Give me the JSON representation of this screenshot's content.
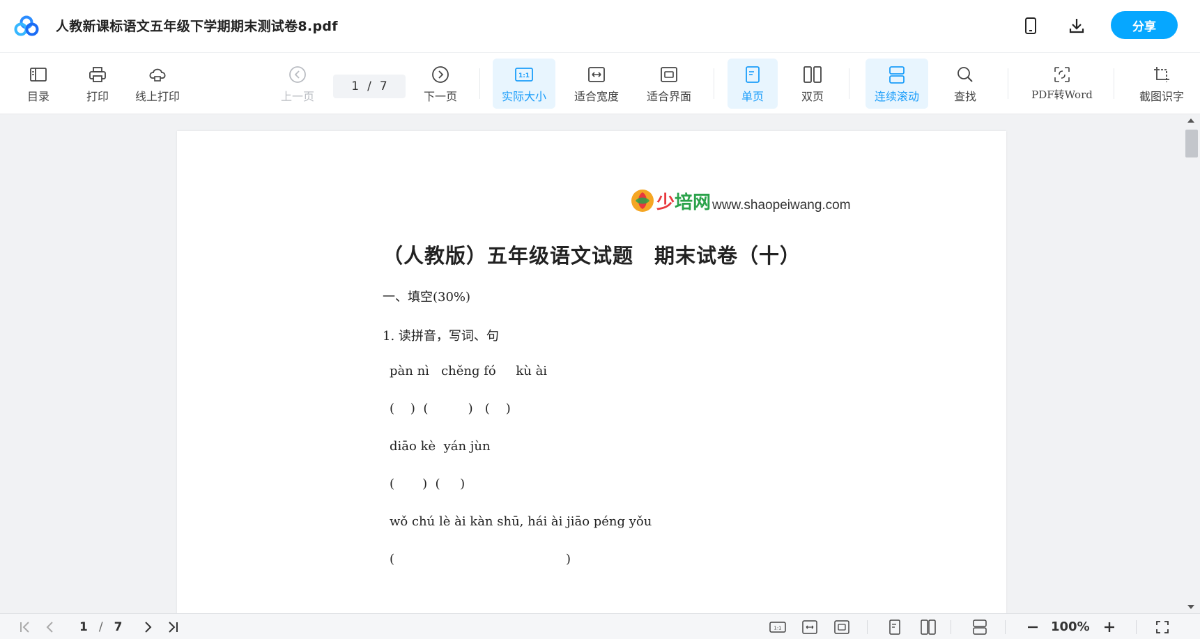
{
  "app": {
    "title": "人教新课标语文五年级下学期期末测试卷8.pdf",
    "share_label": "分享"
  },
  "toolbar": {
    "toc": "目录",
    "print": "打印",
    "online_print": "线上打印",
    "prev_page": "上一页",
    "current_page": "1",
    "page_sep": "/",
    "total_pages": "7",
    "next_page": "下一页",
    "actual_size": "实际大小",
    "fit_width": "适合宽度",
    "fit_screen": "适合界面",
    "single_page": "单页",
    "double_page": "双页",
    "continuous_scroll": "连续滚动",
    "search": "查找",
    "pdf_to_word": "PDF转Word",
    "screenshot_ocr": "截图识字"
  },
  "document": {
    "brand_cn_a": "少",
    "brand_cn_b": "培网",
    "brand_url": "www.shaopeiwang.com",
    "title": "（人教版）五年级语文试题　期末试卷（十）",
    "lines": [
      "一、填空(30%)",
      "1. 读拼音，写词、句",
      "pàn nì   chěng fó     kù ài",
      "(    )  (          )   (    )",
      "diāo kè  yán jùn",
      "(       )  (     )",
      "wǒ chú lè ài kàn shū, hái ài jiāo péng yǒu",
      "(                                           )"
    ]
  },
  "statusbar": {
    "current_page": "1",
    "page_sep": "/",
    "total_pages": "7",
    "zoom": "100%"
  },
  "colors": {
    "accent": "#06a7ff",
    "active_bg": "#e8f5fe",
    "active_text": "#1a9dfa"
  }
}
